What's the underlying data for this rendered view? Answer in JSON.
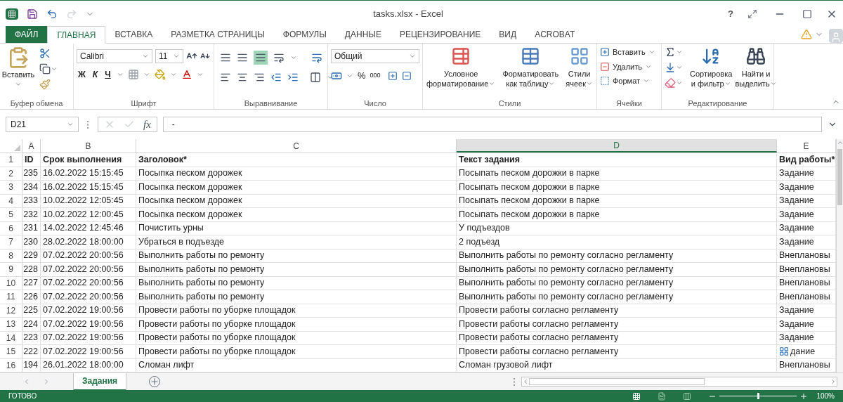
{
  "window": {
    "title": "tasks.xlsx - Excel",
    "help": "?"
  },
  "tabs": [
    {
      "label": "ФАЙЛ",
      "kind": "file",
      "selected": false
    },
    {
      "label": "ГЛАВНАЯ",
      "kind": "tab",
      "selected": true
    },
    {
      "label": "ВСТАВКА",
      "kind": "tab",
      "selected": false
    },
    {
      "label": "РАЗМЕТКА СТРАНИЦЫ",
      "kind": "tab",
      "selected": false
    },
    {
      "label": "ФОРМУЛЫ",
      "kind": "tab",
      "selected": false
    },
    {
      "label": "ДАННЫЕ",
      "kind": "tab",
      "selected": false
    },
    {
      "label": "РЕЦЕНЗИРОВАНИЕ",
      "kind": "tab",
      "selected": false
    },
    {
      "label": "ВИД",
      "kind": "tab",
      "selected": false
    },
    {
      "label": "ACROBAT",
      "kind": "tab",
      "selected": false
    }
  ],
  "ribbon": {
    "clipboard": {
      "paste": "Вставить",
      "group": "Буфер обмена"
    },
    "font": {
      "name": "Calibri",
      "size": "11",
      "bold": "Ж",
      "italic": "К",
      "underline": "Ч",
      "group": "Шрифт"
    },
    "alignment": {
      "group": "Выравнивание"
    },
    "number": {
      "format": "Общий",
      "percent": "%",
      "thousands": "000",
      "group": "Число"
    },
    "styles": {
      "buttons": [
        {
          "lines": [
            "Условное",
            "форматирование"
          ]
        },
        {
          "lines": [
            "Форматировать",
            "как таблицу"
          ]
        },
        {
          "lines": [
            "Стили",
            "ячеек"
          ]
        }
      ],
      "group": "Стили"
    },
    "cells": {
      "buttons": [
        {
          "label": "Вставить",
          "kind": "insert"
        },
        {
          "label": "Удалить",
          "kind": "delete"
        },
        {
          "label": "Формат",
          "kind": "format"
        }
      ],
      "group": "Ячейки"
    },
    "editing": {
      "buttons": [
        {
          "lines": [
            "Сортировка",
            "и фильтр"
          ],
          "kind": "sort"
        },
        {
          "lines": [
            "Найти и",
            "выделить"
          ],
          "kind": "find"
        }
      ],
      "group": "Редактирование"
    }
  },
  "formula_bar": {
    "name_box": "D21",
    "fx": "fx",
    "value": "-"
  },
  "columns": [
    {
      "label": "A",
      "selected": false
    },
    {
      "label": "B",
      "selected": false
    },
    {
      "label": "C",
      "selected": false
    },
    {
      "label": "D",
      "selected": true
    },
    {
      "label": "E",
      "selected": false
    }
  ],
  "rows": [
    {
      "num": "1",
      "kind": "header",
      "cells": [
        "ID",
        "Срок выполнения",
        "Заголовок*",
        "Текст задания",
        "Вид работы*"
      ]
    },
    {
      "num": "2",
      "kind": "data",
      "cells": [
        "235",
        "16.02.2022 15:15:45",
        "Посыпка песком дорожек",
        "Посыпать песком дорожки в парке",
        "Задание"
      ]
    },
    {
      "num": "3",
      "kind": "data",
      "cells": [
        "234",
        "16.02.2022 15:15:45",
        "Посыпка песком дорожек",
        "Посыпать песком дорожки в парке",
        "Задание"
      ]
    },
    {
      "num": "4",
      "kind": "data",
      "cells": [
        "233",
        "10.02.2022 12:05:45",
        "Посыпка песком дорожек",
        "Посыпать песком дорожки в парке",
        "Задание"
      ]
    },
    {
      "num": "5",
      "kind": "data",
      "cells": [
        "232",
        "10.02.2022 12:00:45",
        "Посыпка песком дорожек",
        "Посыпать песком дорожки в парке",
        "Задание"
      ]
    },
    {
      "num": "6",
      "kind": "data",
      "cells": [
        "231",
        "14.02.2022 12:45:46",
        "Почистить урны",
        "У подъездов",
        "Задание"
      ]
    },
    {
      "num": "7",
      "kind": "data",
      "cells": [
        "230",
        "28.02.2022 18:00:00",
        "Убраться в подъезде",
        "2 подъезд",
        "Задание"
      ]
    },
    {
      "num": "8",
      "kind": "data",
      "cells": [
        "229",
        "07.02.2022 20:00:56",
        "Выполнить работы по ремонту",
        "Выполнить работы по ремонту согласно регламенту",
        "Внеплановы"
      ]
    },
    {
      "num": "9",
      "kind": "data",
      "cells": [
        "228",
        "07.02.2022 20:00:56",
        "Выполнить работы по ремонту",
        "Выполнить работы по ремонту согласно регламенту",
        "Внеплановы"
      ]
    },
    {
      "num": "10",
      "kind": "data",
      "cells": [
        "227",
        "07.02.2022 20:00:56",
        "Выполнить работы по ремонту",
        "Выполнить работы по ремонту согласно регламенту",
        "Внеплановы"
      ]
    },
    {
      "num": "11",
      "kind": "data",
      "cells": [
        "226",
        "07.02.2022 20:00:56",
        "Выполнить работы по ремонту",
        "Выполнить работы по ремонту согласно регламенту",
        "Внеплановы"
      ]
    },
    {
      "num": "12",
      "kind": "data",
      "cells": [
        "225",
        "07.02.2022 19:00:56",
        "Провести работы по уборке площадок",
        "Провести работы согласно регламенту",
        "Задание"
      ]
    },
    {
      "num": "13",
      "kind": "data",
      "cells": [
        "224",
        "07.02.2022 19:00:56",
        "Провести работы по уборке площадок",
        "Провести работы согласно регламенту",
        "Задание"
      ]
    },
    {
      "num": "14",
      "kind": "data",
      "cells": [
        "223",
        "07.02.2022 19:00:56",
        "Провести работы по уборке площадок",
        "Провести работы согласно регламенту",
        "Задание"
      ]
    },
    {
      "num": "15",
      "kind": "quick",
      "cells": [
        "222",
        "07.02.2022 19:00:56",
        "Провести работы по уборке площадок",
        "Провести работы согласно регламенту",
        "дание"
      ]
    },
    {
      "num": "16",
      "kind": "data",
      "cells": [
        "194",
        "26.01.2022 18:00:00",
        "Сломан лифт",
        "Сломан грузовой лифт",
        "Внеплановы"
      ]
    }
  ],
  "sheets": [
    {
      "label": "Задания",
      "selected": true
    }
  ],
  "status_bar": {
    "status": "ГОТОВО",
    "views": [
      {
        "kind": "normal",
        "selected": true
      },
      {
        "kind": "layout",
        "selected": false
      },
      {
        "kind": "pagebreak",
        "selected": false
      }
    ],
    "zoom": {
      "level": 0.5,
      "reading": "100%"
    }
  }
}
